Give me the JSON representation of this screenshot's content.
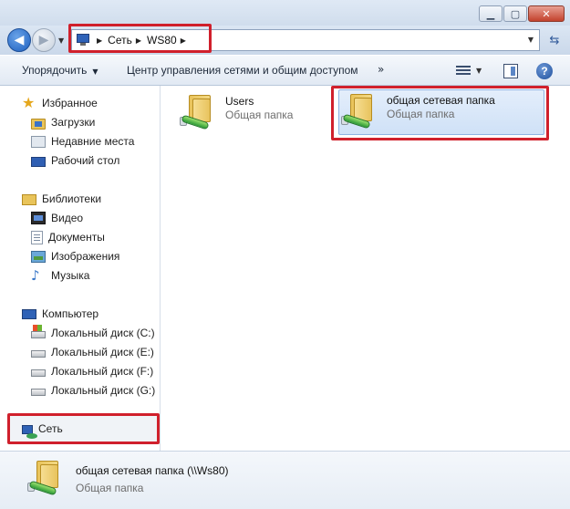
{
  "address": {
    "crumbs": [
      "Сеть",
      "WS80"
    ],
    "computer_icon": "computer-icon"
  },
  "toolbar": {
    "organize": "Упорядочить",
    "network_center": "Центр управления сетями и общим доступом",
    "more": "»"
  },
  "sidebar": {
    "favorites": {
      "title": "Избранное",
      "items": [
        "Загрузки",
        "Недавние места",
        "Рабочий стол"
      ]
    },
    "libraries": {
      "title": "Библиотеки",
      "items": [
        "Видео",
        "Документы",
        "Изображения",
        "Музыка"
      ]
    },
    "computer": {
      "title": "Компьютер",
      "items": [
        "Локальный диск (C:)",
        "Локальный диск (E:)",
        "Локальный диск (F:)",
        "Локальный диск (G:)"
      ]
    },
    "network": {
      "title": "Сеть"
    }
  },
  "content": {
    "tiles": [
      {
        "name": "Users",
        "type": "Общая папка"
      },
      {
        "name": "общая сетевая папка",
        "type": "Общая папка"
      }
    ]
  },
  "details": {
    "name": "общая сетевая папка (\\\\Ws80)",
    "type": "Общая папка"
  },
  "colors": {
    "highlight": "#d0202c",
    "selection": "#cfe1f7"
  }
}
